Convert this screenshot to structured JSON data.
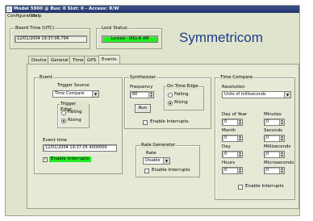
{
  "window": {
    "title": "Model 5900 @ Bus: 0 Slot: 0 - Access: R/W",
    "menu": [
      "Configuration",
      "Help"
    ]
  },
  "header": {
    "board_time_label": "Board Time (UTC)",
    "board_time_value": "12/01/2004 19:37:06.794",
    "lock_status_label": "Lock Status",
    "lock_status_value": "Locked - IRIG-B AM",
    "lock_status_color": "#22ee22",
    "logo_text": "Symmetricom",
    "logo_color": "#1e3a8a"
  },
  "tabs": [
    "Device",
    "General",
    "Time",
    "GPS",
    "Events"
  ],
  "active_tab": "Events",
  "event": {
    "group_label": "Event",
    "trigger_source_label": "Trigger Source",
    "trigger_source_value": "Time Compare",
    "trigger_edge_label": "Trigger Edge",
    "falling_label": "Falling",
    "rising_label": "Rising",
    "selected_edge": "Rising",
    "event_time_label": "Event time",
    "event_time_value": "12/01/2004 19:37:05.4000000",
    "enable_interrupts_label": "Enable Interrupts",
    "enable_interrupts_checked": true,
    "highlight_color": "#22ee22"
  },
  "synthesizer": {
    "group_label": "Synthesizer",
    "frequency_label": "Frequency",
    "frequency_value": "60",
    "on_time_edge_label": "On Time Edge",
    "falling_label": "Falling",
    "rising_label": "Rising",
    "selected_edge": "Rising",
    "run_label": "Run",
    "enable_interrupts_label": "Enable Interrupts",
    "enable_interrupts_checked": false
  },
  "rate_generator": {
    "group_label": "Rate Generator",
    "rate_label": "Rate",
    "rate_value": "Disable",
    "enable_interrupts_label": "Enable Interrupts",
    "enable_interrupts_checked": false
  },
  "time_compare": {
    "group_label": "Time Compare",
    "resolution_label": "Resolution",
    "resolution_value": "Units of milliseconds",
    "day_of_year_label": "Day of Year",
    "day_of_year_value": "0",
    "month_label": "Month",
    "month_value": "0",
    "day_label": "Day",
    "day_value": "0",
    "hours_label": "Hours",
    "hours_value": "0",
    "minutes_label": "Minutes",
    "minutes_value": "0",
    "seconds_label": "Seconds",
    "seconds_value": "0",
    "milliseconds_label": "Milliseconds",
    "milliseconds_value": "0",
    "microseconds_label": "Microseconds",
    "microseconds_value": "0",
    "enable_interrupts_label": "Enable Interrupts",
    "enable_interrupts_checked": false
  }
}
